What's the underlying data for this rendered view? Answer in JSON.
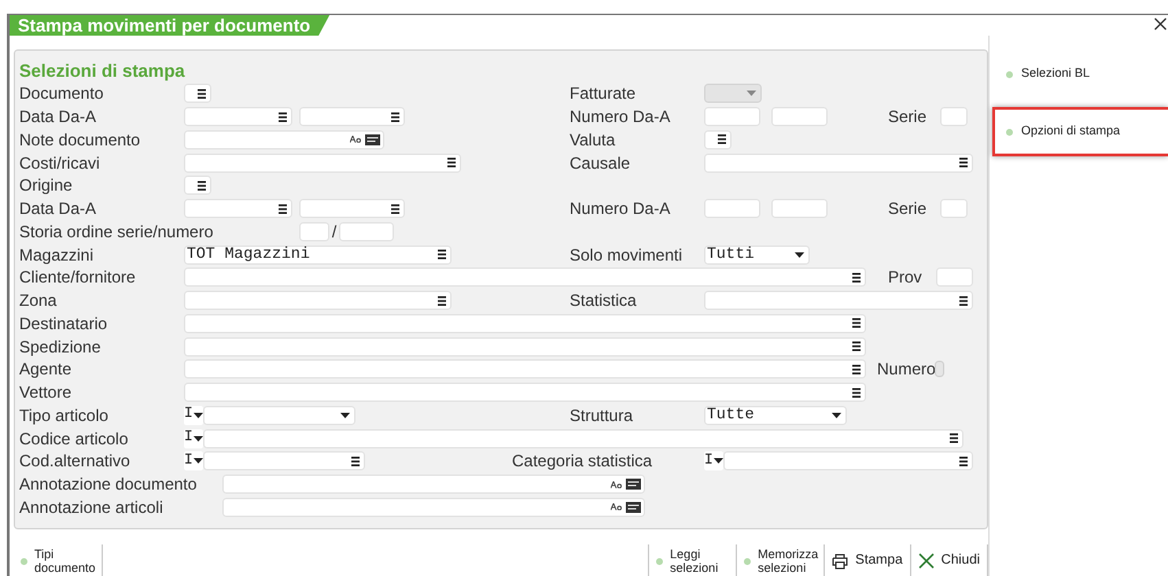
{
  "window": {
    "title": "Stampa movimenti per documento"
  },
  "section_title": "Selezioni di stampa",
  "rows": [
    {
      "cells": [
        {
          "kind": "label",
          "text": "Documento"
        },
        {
          "kind": "menu"
        },
        {
          "kind": "label",
          "text": "Fatturate"
        },
        {
          "kind": "select",
          "disabled": true
        }
      ]
    },
    {
      "cells": [
        {
          "kind": "label",
          "text": "Data Da-A"
        },
        {
          "kind": "menu"
        },
        {
          "kind": "menu"
        },
        {
          "kind": "label",
          "text": "Numero Da-A"
        },
        {
          "kind": "input"
        },
        {
          "kind": "input"
        },
        {
          "kind": "label",
          "text": "Serie"
        },
        {
          "kind": "input"
        }
      ]
    },
    {
      "cells": [
        {
          "kind": "label",
          "text": "Note  documento"
        },
        {
          "kind": "note"
        },
        {
          "kind": "label",
          "text": "Valuta"
        },
        {
          "kind": "menu"
        }
      ]
    },
    {
      "cells": [
        {
          "kind": "label",
          "text": "Costi/ricavi"
        },
        {
          "kind": "menu"
        },
        {
          "kind": "label",
          "text": "Causale"
        },
        {
          "kind": "menu"
        }
      ]
    },
    {
      "cells": [
        {
          "kind": "label",
          "text": "Origine"
        },
        {
          "kind": "menu"
        }
      ]
    },
    {
      "cells": [
        {
          "kind": "label",
          "text": "Data Da-A"
        },
        {
          "kind": "menu"
        },
        {
          "kind": "menu"
        },
        {
          "kind": "label",
          "text": "Numero Da-A"
        },
        {
          "kind": "input"
        },
        {
          "kind": "input"
        },
        {
          "kind": "label",
          "text": "Serie"
        },
        {
          "kind": "input"
        }
      ]
    },
    {
      "cells": [
        {
          "kind": "label",
          "text": "Storia ordine serie/numero"
        },
        {
          "kind": "input"
        },
        {
          "kind": "label",
          "text": "/"
        },
        {
          "kind": "input"
        }
      ]
    },
    {
      "cells": [
        {
          "kind": "label",
          "text": "Magazzini"
        },
        {
          "kind": "menu",
          "value": "TOT Magazzini"
        },
        {
          "kind": "label",
          "text": "Solo movimenti"
        },
        {
          "kind": "select",
          "value": "Tutti",
          "disabled": false
        }
      ]
    },
    {
      "cells": [
        {
          "kind": "label",
          "text": "Cliente/fornitore"
        },
        {
          "kind": "menu"
        },
        {
          "kind": "label",
          "text": "Prov"
        },
        {
          "kind": "input"
        }
      ]
    },
    {
      "cells": [
        {
          "kind": "label",
          "text": "Zona"
        },
        {
          "kind": "menu"
        },
        {
          "kind": "label",
          "text": "Statistica"
        },
        {
          "kind": "menu"
        }
      ]
    },
    {
      "cells": [
        {
          "kind": "label",
          "text": "Destinatario"
        },
        {
          "kind": "menu"
        }
      ]
    },
    {
      "cells": [
        {
          "kind": "label",
          "text": "Spedizione"
        },
        {
          "kind": "menu"
        }
      ]
    },
    {
      "cells": [
        {
          "kind": "label",
          "text": "Agente"
        },
        {
          "kind": "menu"
        },
        {
          "kind": "label",
          "text": "Numero"
        },
        {
          "kind": "toggle"
        }
      ]
    },
    {
      "cells": [
        {
          "kind": "label",
          "text": "Vettore"
        },
        {
          "kind": "menu"
        }
      ]
    },
    {
      "cells": [
        {
          "kind": "label",
          "text": "Tipo articolo"
        },
        {
          "kind": "prefix",
          "value": "I"
        },
        {
          "kind": "select",
          "disabled": false
        },
        {
          "kind": "label",
          "text": "Struttura"
        },
        {
          "kind": "select",
          "value": "Tutte",
          "disabled": false
        }
      ]
    },
    {
      "cells": [
        {
          "kind": "label",
          "text": "Codice articolo"
        },
        {
          "kind": "prefix",
          "value": "I"
        },
        {
          "kind": "menu"
        }
      ]
    },
    {
      "cells": [
        {
          "kind": "label",
          "text": "Cod.alternativo"
        },
        {
          "kind": "prefix",
          "value": "I"
        },
        {
          "kind": "menu"
        },
        {
          "kind": "label",
          "text": "Categoria statistica"
        },
        {
          "kind": "prefix",
          "value": "I"
        },
        {
          "kind": "menu"
        }
      ]
    },
    {
      "cells": [
        {
          "kind": "label",
          "text": "Annotazione documento"
        },
        {
          "kind": "note"
        }
      ]
    },
    {
      "cells": [
        {
          "kind": "label",
          "text": "Annotazione articoli"
        },
        {
          "kind": "note"
        }
      ]
    }
  ],
  "sidebar": {
    "items": [
      {
        "label": "Selezioni BL",
        "highlighted": false
      },
      {
        "label": "Opzioni di stampa",
        "highlighted": true
      }
    ]
  },
  "toolbar": {
    "left": [
      {
        "label": "Tipi documento",
        "kind": "dot"
      }
    ],
    "right": [
      {
        "label": "Leggi selezioni",
        "kind": "dot"
      },
      {
        "label": "Memorizza selezioni",
        "kind": "dot"
      },
      {
        "label": "Stampa",
        "kind": "print"
      },
      {
        "label": "Chiudi",
        "kind": "close"
      }
    ]
  }
}
